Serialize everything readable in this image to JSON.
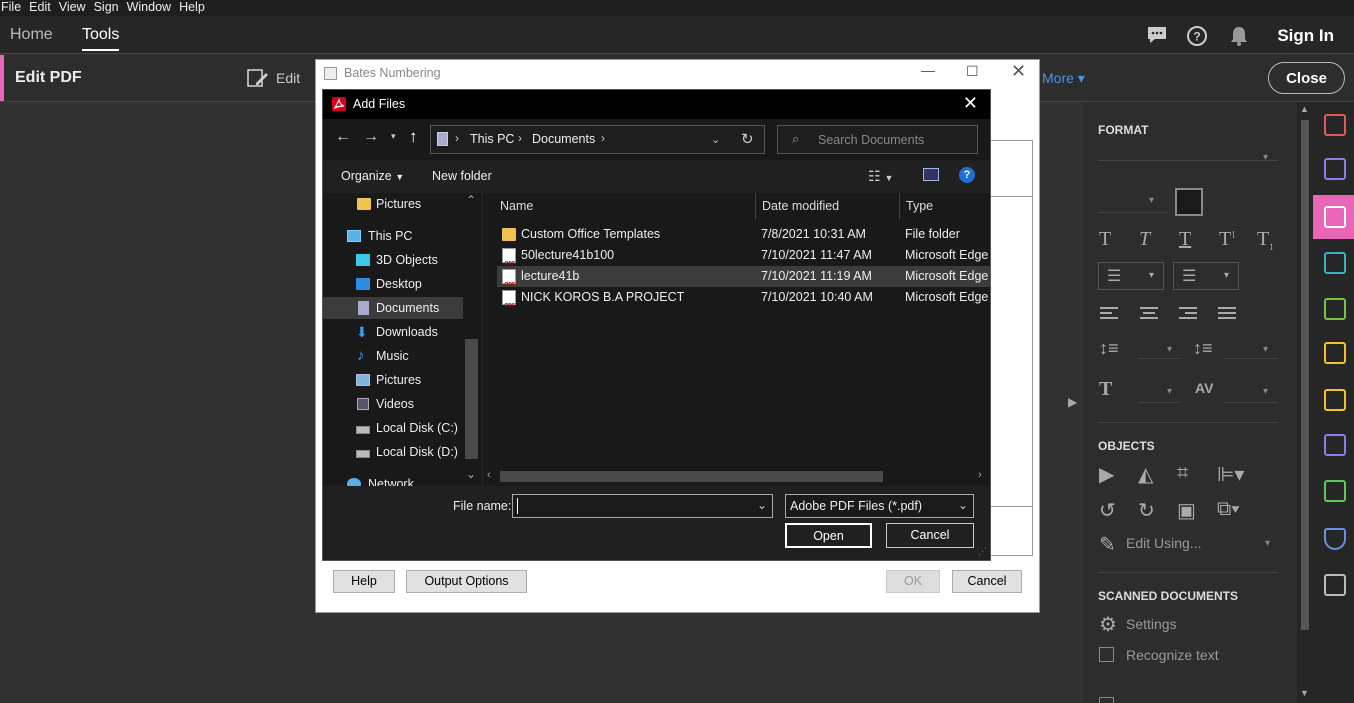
{
  "menu": [
    "File",
    "Edit",
    "View",
    "Sign",
    "Window",
    "Help"
  ],
  "tabs": {
    "home": "Home",
    "tools": "Tools"
  },
  "header": {
    "sign_in": "Sign In"
  },
  "toolbar": {
    "title": "Edit PDF",
    "edit": "Edit",
    "more": "More",
    "close": "Close"
  },
  "right_panel": {
    "format_heading": "FORMAT",
    "objects_heading": "OBJECTS",
    "edit_using": "Edit Using...",
    "scanned_heading": "SCANNED DOCUMENTS",
    "settings": "Settings",
    "recognize_text": "Recognize text"
  },
  "bates_dialog": {
    "title": "Bates Numbering",
    "help": "Help",
    "output_options": "Output Options",
    "ok": "OK",
    "cancel": "Cancel"
  },
  "add_files": {
    "title": "Add Files",
    "breadcrumb": [
      "This PC",
      "Documents"
    ],
    "search_placeholder": "Search Documents",
    "organize": "Organize",
    "new_folder": "New folder",
    "nav_items": [
      "Pictures",
      "This PC",
      "3D Objects",
      "Desktop",
      "Documents",
      "Downloads",
      "Music",
      "Pictures",
      "Videos",
      "Local Disk (C:)",
      "Local Disk (D:)",
      "Network"
    ],
    "columns": {
      "name": "Name",
      "date": "Date modified",
      "type": "Type"
    },
    "files": [
      {
        "name": "Custom Office Templates",
        "date": "7/8/2021 10:31 AM",
        "type": "File folder",
        "kind": "folder"
      },
      {
        "name": "50lecture41b100",
        "date": "7/10/2021 11:47 AM",
        "type": "Microsoft Edge PDF",
        "kind": "pdf"
      },
      {
        "name": "lecture41b",
        "date": "7/10/2021 11:19 AM",
        "type": "Microsoft Edge PDF",
        "kind": "pdf"
      },
      {
        "name": "NICK KOROS B.A PROJECT",
        "date": "7/10/2021 10:40 AM",
        "type": "Microsoft Edge PDF",
        "kind": "pdf"
      }
    ],
    "file_name_label": "File name:",
    "file_name_value": "",
    "file_type": "Adobe PDF Files (*.pdf)",
    "open": "Open",
    "cancel": "Cancel"
  }
}
